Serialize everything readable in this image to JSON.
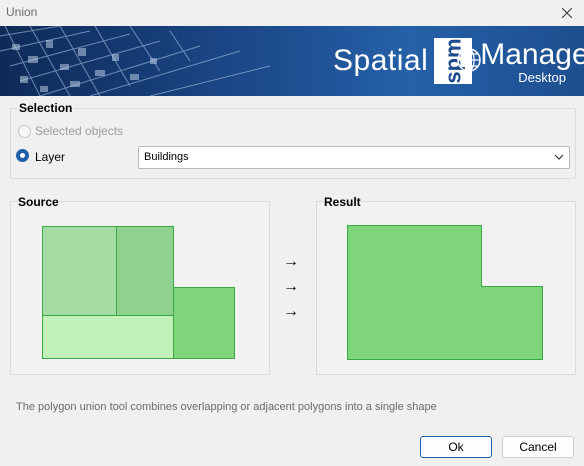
{
  "window": {
    "title": "Union"
  },
  "banner": {
    "brand_left": "Spatial",
    "brand_logo": "spm",
    "brand_right": "Manager",
    "brand_sub": "Desktop"
  },
  "selection": {
    "title": "Selection",
    "option_selected_objects": "Selected objects",
    "option_layer": "Layer",
    "layer_value": "Buildings"
  },
  "source": {
    "title": "Source"
  },
  "result": {
    "title": "Result"
  },
  "arrows": [
    "→",
    "→",
    "→"
  ],
  "description": "The polygon union tool combines overlapping or adjacent polygons into a single shape",
  "buttons": {
    "ok": "Ok",
    "cancel": "Cancel"
  },
  "colors": {
    "accent": "#1f5fa8",
    "polygon_fill": "#7fd67a",
    "polygon_stroke": "#3aa845"
  },
  "icons": [
    "close-icon",
    "chevron-down-icon",
    "arrow-right-icon",
    "globe-icon"
  ]
}
